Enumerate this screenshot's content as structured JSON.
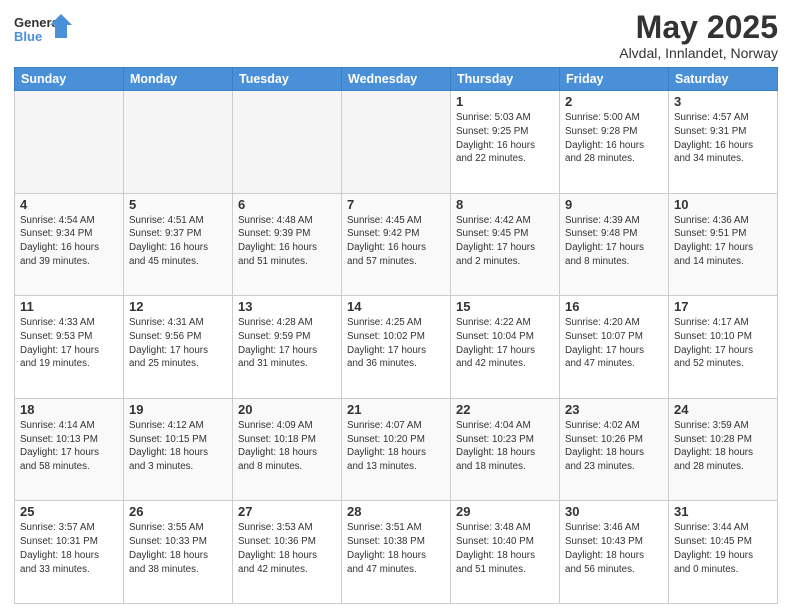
{
  "logo": {
    "line1": "General",
    "line2": "Blue"
  },
  "header": {
    "month": "May 2025",
    "location": "Alvdal, Innlandet, Norway"
  },
  "weekdays": [
    "Sunday",
    "Monday",
    "Tuesday",
    "Wednesday",
    "Thursday",
    "Friday",
    "Saturday"
  ],
  "weeks": [
    [
      {
        "day": "",
        "info": ""
      },
      {
        "day": "",
        "info": ""
      },
      {
        "day": "",
        "info": ""
      },
      {
        "day": "",
        "info": ""
      },
      {
        "day": "1",
        "info": "Sunrise: 5:03 AM\nSunset: 9:25 PM\nDaylight: 16 hours\nand 22 minutes."
      },
      {
        "day": "2",
        "info": "Sunrise: 5:00 AM\nSunset: 9:28 PM\nDaylight: 16 hours\nand 28 minutes."
      },
      {
        "day": "3",
        "info": "Sunrise: 4:57 AM\nSunset: 9:31 PM\nDaylight: 16 hours\nand 34 minutes."
      }
    ],
    [
      {
        "day": "4",
        "info": "Sunrise: 4:54 AM\nSunset: 9:34 PM\nDaylight: 16 hours\nand 39 minutes."
      },
      {
        "day": "5",
        "info": "Sunrise: 4:51 AM\nSunset: 9:37 PM\nDaylight: 16 hours\nand 45 minutes."
      },
      {
        "day": "6",
        "info": "Sunrise: 4:48 AM\nSunset: 9:39 PM\nDaylight: 16 hours\nand 51 minutes."
      },
      {
        "day": "7",
        "info": "Sunrise: 4:45 AM\nSunset: 9:42 PM\nDaylight: 16 hours\nand 57 minutes."
      },
      {
        "day": "8",
        "info": "Sunrise: 4:42 AM\nSunset: 9:45 PM\nDaylight: 17 hours\nand 2 minutes."
      },
      {
        "day": "9",
        "info": "Sunrise: 4:39 AM\nSunset: 9:48 PM\nDaylight: 17 hours\nand 8 minutes."
      },
      {
        "day": "10",
        "info": "Sunrise: 4:36 AM\nSunset: 9:51 PM\nDaylight: 17 hours\nand 14 minutes."
      }
    ],
    [
      {
        "day": "11",
        "info": "Sunrise: 4:33 AM\nSunset: 9:53 PM\nDaylight: 17 hours\nand 19 minutes."
      },
      {
        "day": "12",
        "info": "Sunrise: 4:31 AM\nSunset: 9:56 PM\nDaylight: 17 hours\nand 25 minutes."
      },
      {
        "day": "13",
        "info": "Sunrise: 4:28 AM\nSunset: 9:59 PM\nDaylight: 17 hours\nand 31 minutes."
      },
      {
        "day": "14",
        "info": "Sunrise: 4:25 AM\nSunset: 10:02 PM\nDaylight: 17 hours\nand 36 minutes."
      },
      {
        "day": "15",
        "info": "Sunrise: 4:22 AM\nSunset: 10:04 PM\nDaylight: 17 hours\nand 42 minutes."
      },
      {
        "day": "16",
        "info": "Sunrise: 4:20 AM\nSunset: 10:07 PM\nDaylight: 17 hours\nand 47 minutes."
      },
      {
        "day": "17",
        "info": "Sunrise: 4:17 AM\nSunset: 10:10 PM\nDaylight: 17 hours\nand 52 minutes."
      }
    ],
    [
      {
        "day": "18",
        "info": "Sunrise: 4:14 AM\nSunset: 10:13 PM\nDaylight: 17 hours\nand 58 minutes."
      },
      {
        "day": "19",
        "info": "Sunrise: 4:12 AM\nSunset: 10:15 PM\nDaylight: 18 hours\nand 3 minutes."
      },
      {
        "day": "20",
        "info": "Sunrise: 4:09 AM\nSunset: 10:18 PM\nDaylight: 18 hours\nand 8 minutes."
      },
      {
        "day": "21",
        "info": "Sunrise: 4:07 AM\nSunset: 10:20 PM\nDaylight: 18 hours\nand 13 minutes."
      },
      {
        "day": "22",
        "info": "Sunrise: 4:04 AM\nSunset: 10:23 PM\nDaylight: 18 hours\nand 18 minutes."
      },
      {
        "day": "23",
        "info": "Sunrise: 4:02 AM\nSunset: 10:26 PM\nDaylight: 18 hours\nand 23 minutes."
      },
      {
        "day": "24",
        "info": "Sunrise: 3:59 AM\nSunset: 10:28 PM\nDaylight: 18 hours\nand 28 minutes."
      }
    ],
    [
      {
        "day": "25",
        "info": "Sunrise: 3:57 AM\nSunset: 10:31 PM\nDaylight: 18 hours\nand 33 minutes."
      },
      {
        "day": "26",
        "info": "Sunrise: 3:55 AM\nSunset: 10:33 PM\nDaylight: 18 hours\nand 38 minutes."
      },
      {
        "day": "27",
        "info": "Sunrise: 3:53 AM\nSunset: 10:36 PM\nDaylight: 18 hours\nand 42 minutes."
      },
      {
        "day": "28",
        "info": "Sunrise: 3:51 AM\nSunset: 10:38 PM\nDaylight: 18 hours\nand 47 minutes."
      },
      {
        "day": "29",
        "info": "Sunrise: 3:48 AM\nSunset: 10:40 PM\nDaylight: 18 hours\nand 51 minutes."
      },
      {
        "day": "30",
        "info": "Sunrise: 3:46 AM\nSunset: 10:43 PM\nDaylight: 18 hours\nand 56 minutes."
      },
      {
        "day": "31",
        "info": "Sunrise: 3:44 AM\nSunset: 10:45 PM\nDaylight: 19 hours\nand 0 minutes."
      }
    ]
  ]
}
